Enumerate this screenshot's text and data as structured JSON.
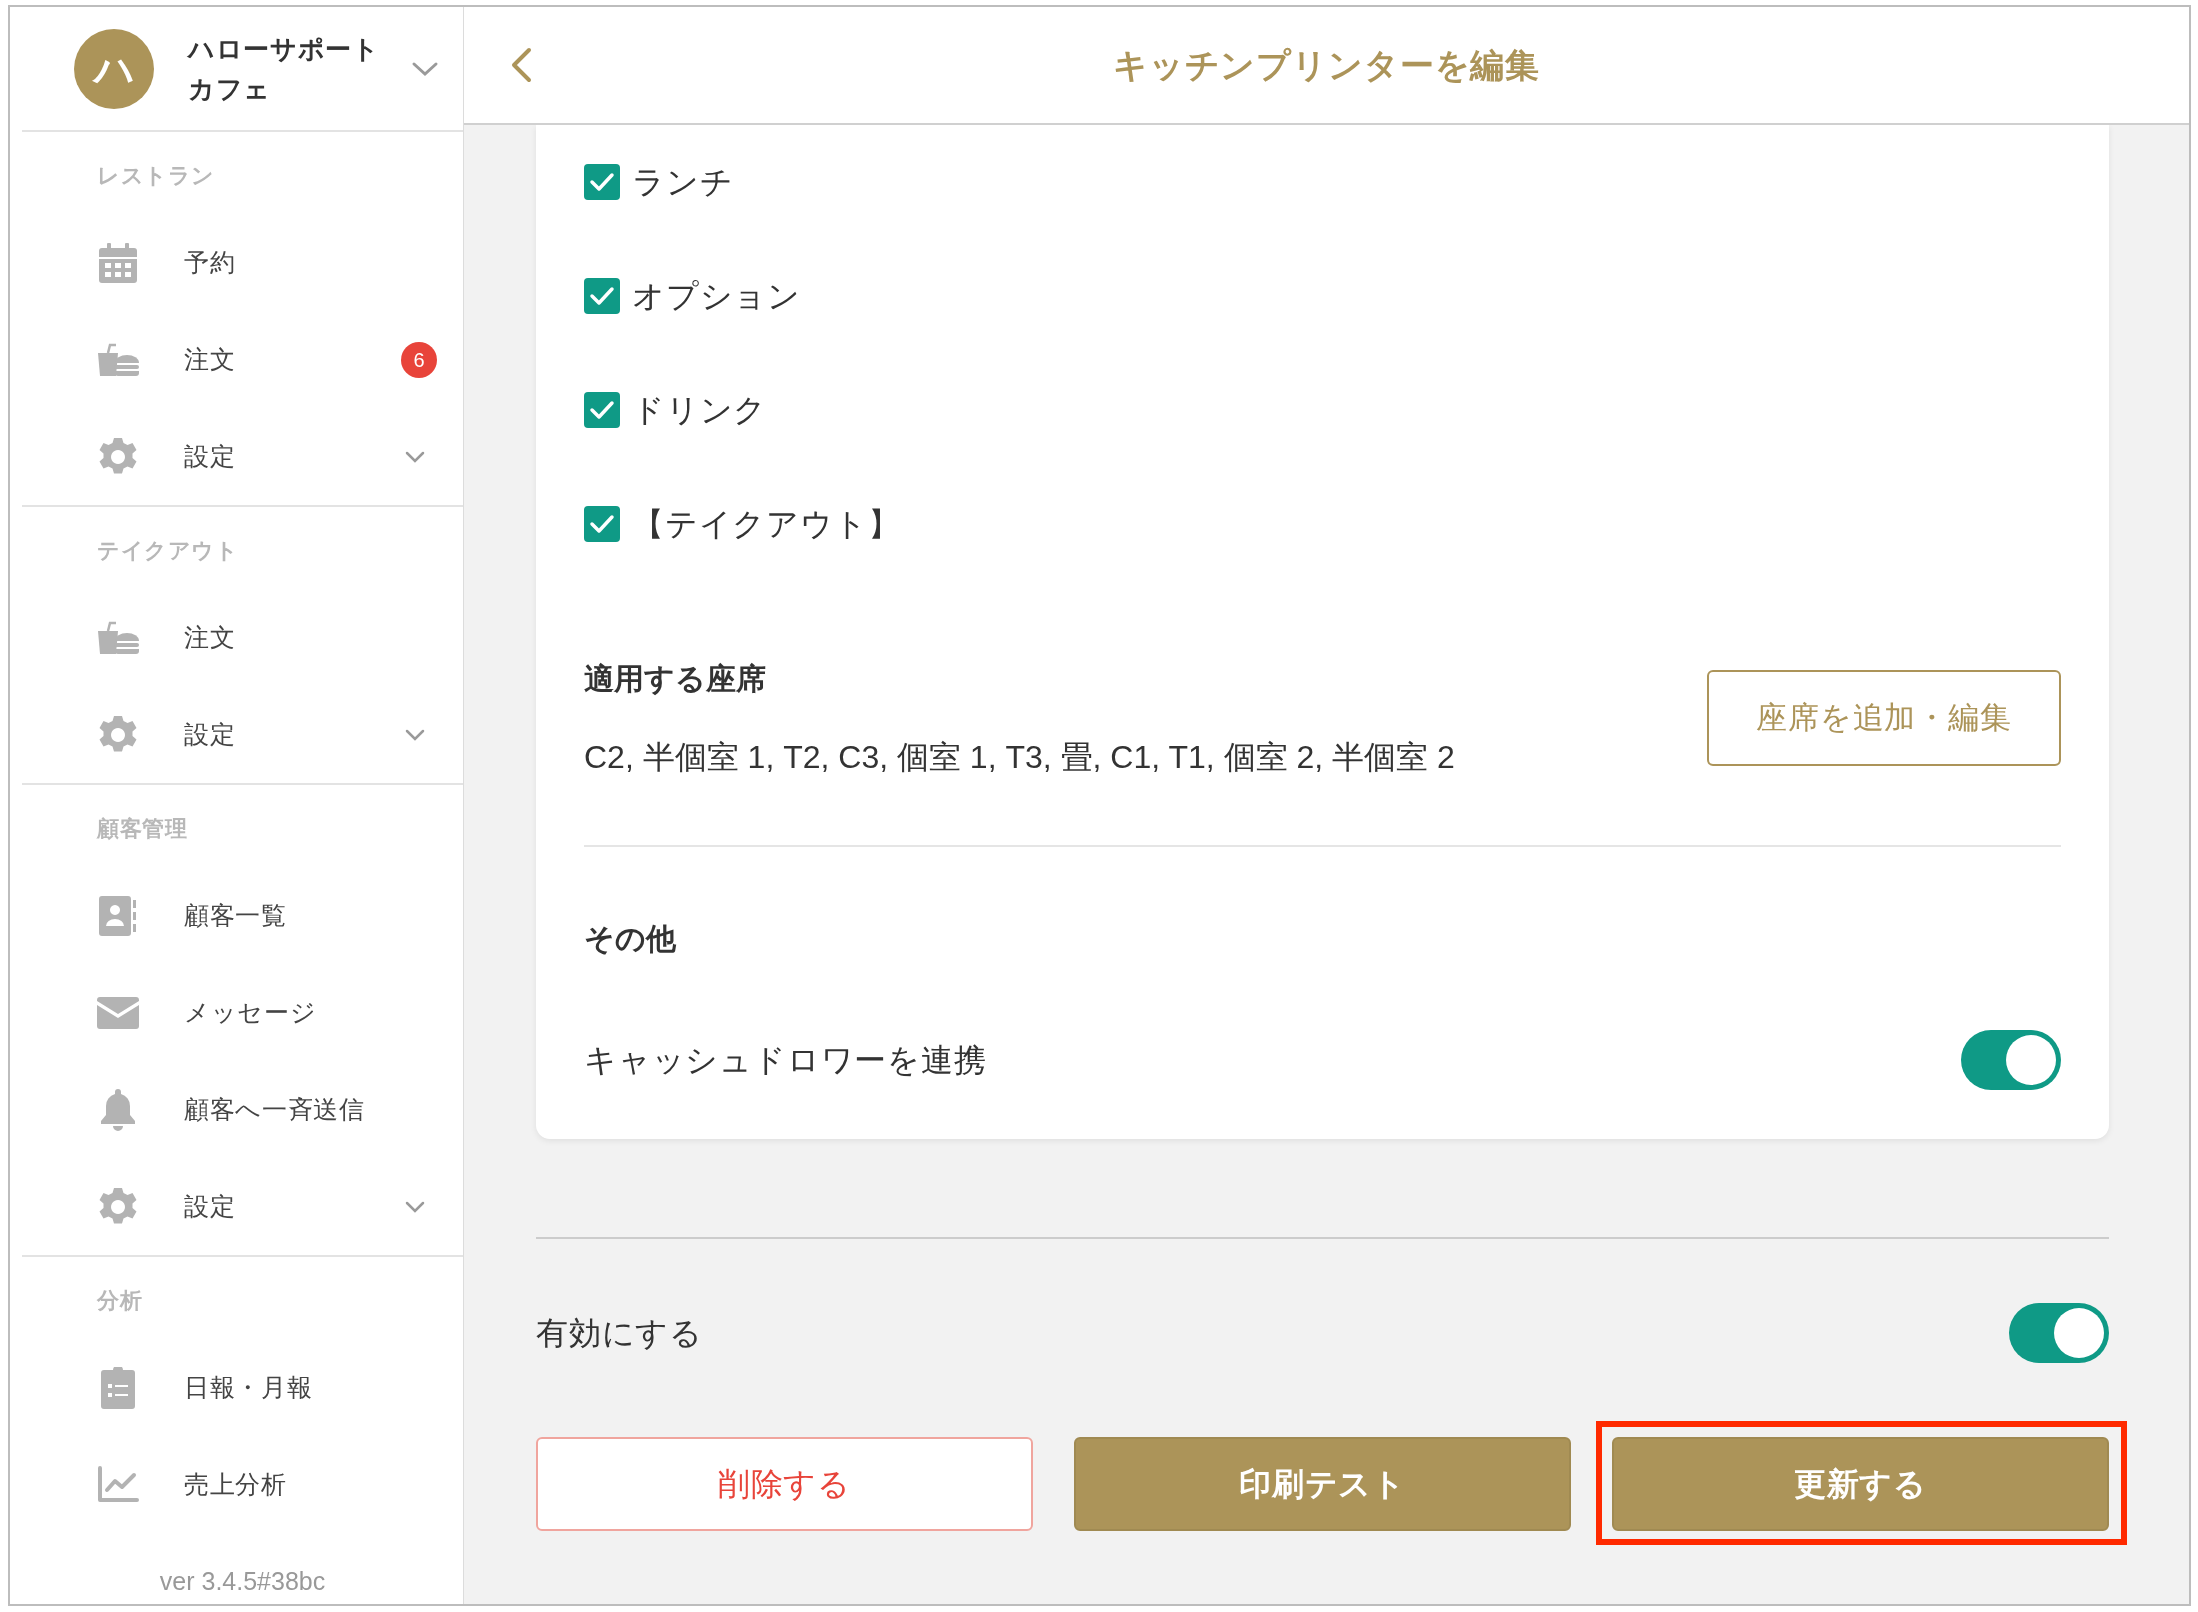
{
  "sidebar": {
    "account": {
      "initial": "ハ",
      "name": "ハローサポートカフェ"
    },
    "sections": [
      {
        "title": "レストラン",
        "items": [
          {
            "kind": "calendar",
            "label": "予約"
          },
          {
            "kind": "food",
            "label": "注文",
            "badge": "6"
          },
          {
            "kind": "gear",
            "label": "設定",
            "expanded": false
          }
        ]
      },
      {
        "title": "テイクアウト",
        "items": [
          {
            "kind": "food",
            "label": "注文"
          },
          {
            "kind": "gear",
            "label": "設定",
            "expanded": false
          }
        ]
      },
      {
        "title": "顧客管理",
        "items": [
          {
            "kind": "contact",
            "label": "顧客一覧"
          },
          {
            "kind": "mail",
            "label": "メッセージ"
          },
          {
            "kind": "bell",
            "label": "顧客へ一斉送信"
          },
          {
            "kind": "gear",
            "label": "設定",
            "expanded": false
          }
        ]
      },
      {
        "title": "分析",
        "items": [
          {
            "kind": "clipboard",
            "label": "日報・月報"
          },
          {
            "kind": "chart",
            "label": "売上分析"
          }
        ]
      }
    ],
    "version": "ver 3.4.5#38bc"
  },
  "header": {
    "title": "キッチンプリンターを編集"
  },
  "categories": [
    {
      "label": "ランチ",
      "checked": true
    },
    {
      "label": "オプション",
      "checked": true
    },
    {
      "label": "ドリンク",
      "checked": true
    },
    {
      "label": "【テイクアウト】",
      "checked": true
    }
  ],
  "seats": {
    "heading": "適用する座席",
    "value": "C2, 半個室 1, T2, C3, 個室 1, T3, 畳, C1, T1, 個室 2, 半個室 2",
    "button": "座席を追加・編集"
  },
  "other": {
    "heading": "その他",
    "cash_drawer": {
      "label": "キャッシュドロワーを連携",
      "on": true
    }
  },
  "enable": {
    "label": "有効にする",
    "on": true
  },
  "buttons": [
    {
      "kind": "danger",
      "label": "削除する",
      "highlighted": false
    },
    {
      "kind": "primary",
      "label": "印刷テスト",
      "highlighted": false
    },
    {
      "kind": "primary",
      "label": "更新する",
      "highlighted": true
    }
  ]
}
